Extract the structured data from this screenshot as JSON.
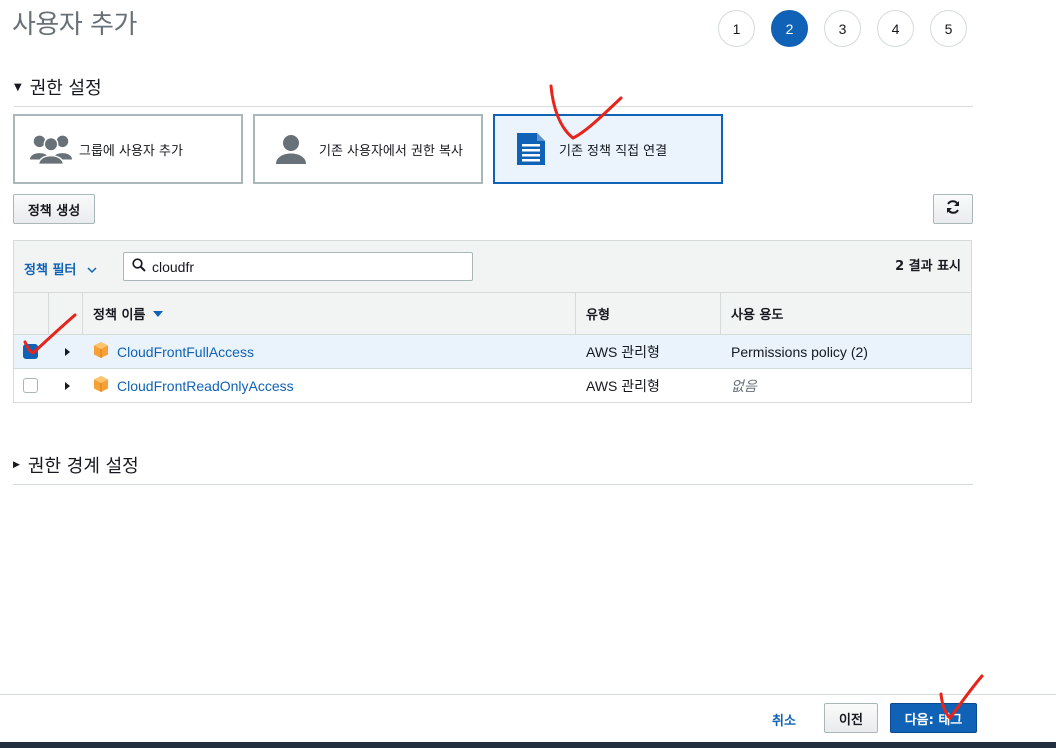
{
  "page": {
    "title": "사용자 추가"
  },
  "steps": [
    {
      "label": "1",
      "active": false
    },
    {
      "label": "2",
      "active": true
    },
    {
      "label": "3",
      "active": false
    },
    {
      "label": "4",
      "active": false
    },
    {
      "label": "5",
      "active": false
    }
  ],
  "permissions": {
    "section_title": "권한 설정",
    "options": [
      {
        "label": "그룹에 사용자 추가",
        "icon": "group-icon",
        "selected": false
      },
      {
        "label": "기존 사용자에서 권한 복사",
        "icon": "user-icon",
        "selected": false
      },
      {
        "label": "기존 정책 직접 연결",
        "icon": "document-icon",
        "selected": true
      }
    ],
    "create_policy_label": "정책 생성",
    "refresh_icon": "refresh-icon"
  },
  "table": {
    "filter_label": "정책 필터",
    "search_value": "cloudfr",
    "result_count": "2 결과 표시",
    "headers": {
      "name": "정책 이름",
      "type": "유형",
      "use": "사용 용도"
    },
    "rows": [
      {
        "checked": true,
        "name": "CloudFrontFullAccess",
        "type": "AWS 관리형",
        "use": "Permissions policy (2)",
        "use_muted": false
      },
      {
        "checked": false,
        "name": "CloudFrontReadOnlyAccess",
        "type": "AWS 관리형",
        "use": "없음",
        "use_muted": true
      }
    ]
  },
  "boundary": {
    "section_title": "권한 경계 설정"
  },
  "footer": {
    "cancel_label": "취소",
    "prev_label": "이전",
    "next_label": "다음: 태그"
  },
  "colors": {
    "primary": "#0f62b5",
    "annotation": "#e8241a",
    "aws_orange": "#f7a035"
  }
}
